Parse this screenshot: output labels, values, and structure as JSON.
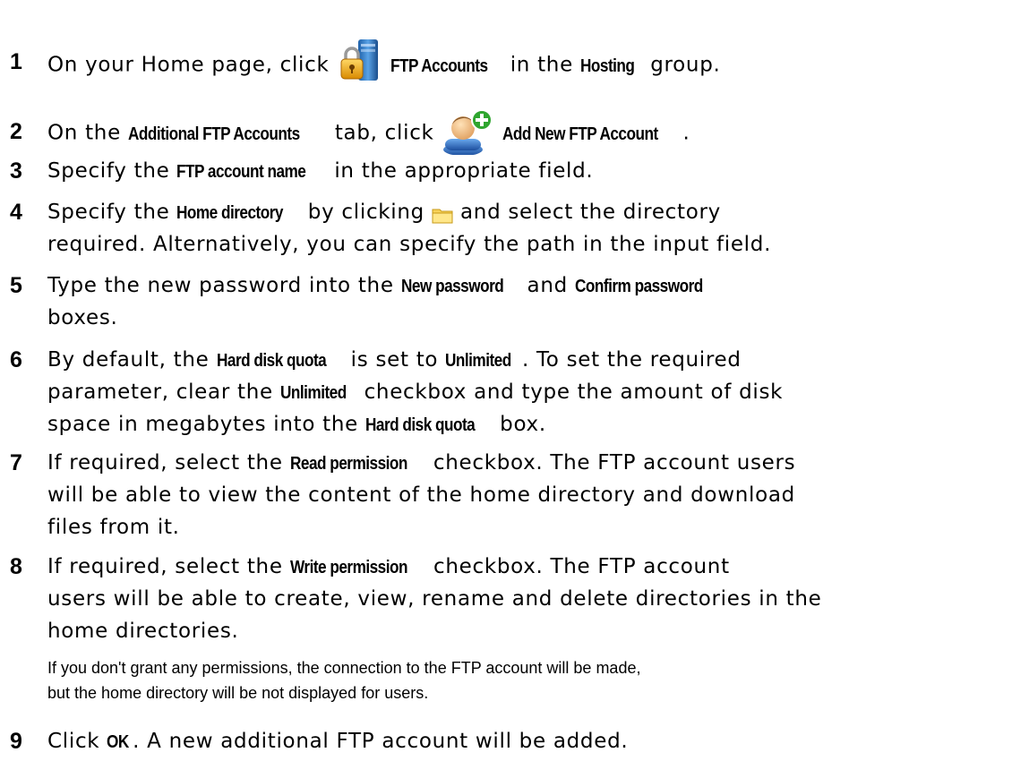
{
  "steps": [
    {
      "num": "1",
      "parts": {
        "a": "On your Home page, click ",
        "b": "FTP Accounts",
        "c": " in the ",
        "d": "Hosting",
        "e": " group."
      }
    },
    {
      "num": "2",
      "parts": {
        "a": "On the ",
        "b": "Additional FTP Accounts",
        "c": " tab, click ",
        "d": "Add New FTP Account",
        "e": "."
      }
    },
    {
      "num": "3",
      "parts": {
        "a": "Specify the ",
        "b": "FTP account name",
        "c": " in the appropriate field."
      }
    },
    {
      "num": "4",
      "parts": {
        "a": "Specify the ",
        "b": "Home directory",
        "c": " by clicking ",
        "d": " and select the directory",
        "e": "required. Alternatively, you can specify the path in the input field."
      }
    },
    {
      "num": "5",
      "parts": {
        "a": "Type the new password into the ",
        "b": "New password",
        "c": " and ",
        "d": "Confirm password",
        "e": "boxes."
      }
    },
    {
      "num": "6",
      "parts": {
        "a": "By default, the ",
        "b": "Hard disk quota",
        "c": " is set to ",
        "d": "Unlimited",
        "e": ". To set the required",
        "f": "parameter, clear the ",
        "g": "Unlimited",
        "h": " checkbox and type the amount of disk",
        "i": "space in megabytes into the ",
        "j": "Hard disk quota",
        "k": " box."
      }
    },
    {
      "num": "7",
      "parts": {
        "a": "If required, select the ",
        "b": "Read permission",
        "c": " checkbox. The FTP account users",
        "d": "will be able to view the content of the home directory and download",
        "e": "files from it."
      }
    },
    {
      "num": "8",
      "parts": {
        "a": "If required, select the ",
        "b": "Write permission",
        "c": " checkbox. The FTP account",
        "d": "users will be able to create, view, rename and delete directories in the",
        "e": "home directories."
      }
    },
    {
      "num": "9",
      "parts": {
        "a": "Click ",
        "b": "OK",
        "c": ". A new additional FTP account will be added."
      }
    }
  ],
  "note": {
    "line1": "If you don't grant any permissions, the connection to the FTP account will be made,",
    "line2": "but the home directory will be not displayed for users."
  },
  "icons": {
    "step1": "ftp-accounts-icon",
    "step2": "add-user-icon",
    "step4": "folder-icon"
  }
}
